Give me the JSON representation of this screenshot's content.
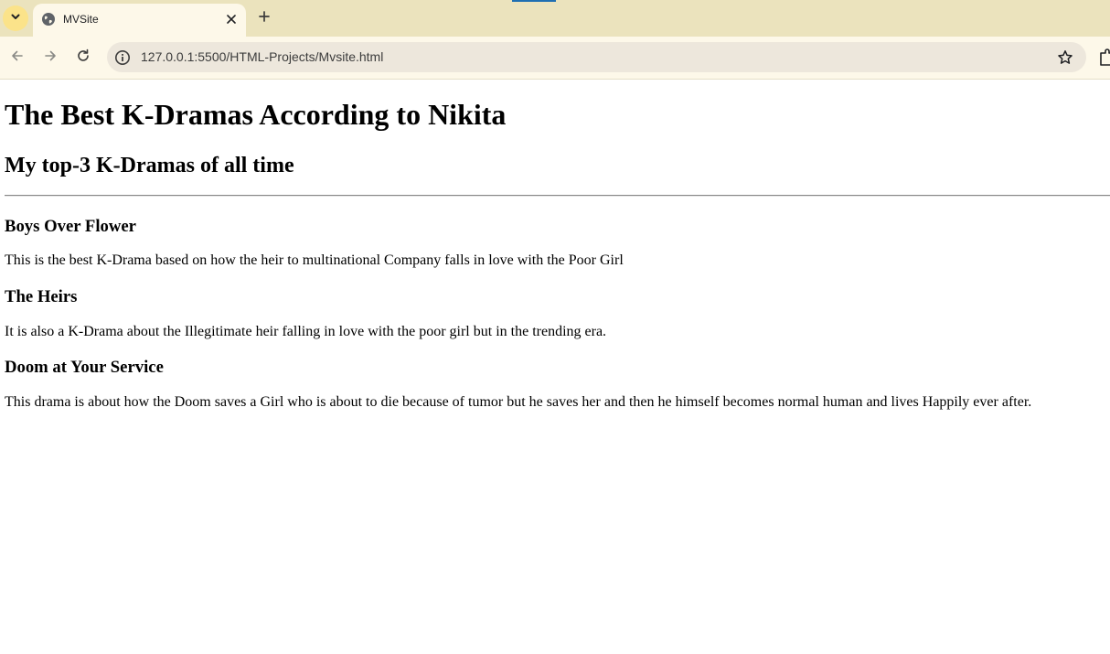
{
  "browser": {
    "tab": {
      "title": "MVSite"
    },
    "address_bar": {
      "url": "127.0.0.1:5500/HTML-Projects/Mvsite.html"
    },
    "colors": {
      "tabstrip": "#ebe3bd",
      "active_tab": "#fdf8e9",
      "omnibox": "#ede7dc",
      "tab_search_button": "#fbe38a"
    },
    "icons": [
      "chevron-down-icon",
      "globe-icon",
      "close-icon",
      "plus-icon",
      "back-arrow-icon",
      "forward-arrow-icon",
      "reload-icon",
      "info-icon",
      "star-icon",
      "puzzle-icon"
    ]
  },
  "page": {
    "heading": "The Best K-Dramas According to Nikita",
    "subheading": "My top-3 K-Dramas of all time",
    "dramas": [
      {
        "title": "Boys Over Flower",
        "description": "This is the best K-Drama based on how the heir to multinational Company falls in love with the Poor Girl"
      },
      {
        "title": "The Heirs",
        "description": "It is also a K-Drama about the Illegitimate heir falling in love with the poor girl but in the trending era."
      },
      {
        "title": "Doom at Your Service",
        "description": "This drama is about how the Doom saves a Girl who is about to die because of tumor but he saves her and then he himself becomes normal human and lives Happily ever after."
      }
    ]
  }
}
